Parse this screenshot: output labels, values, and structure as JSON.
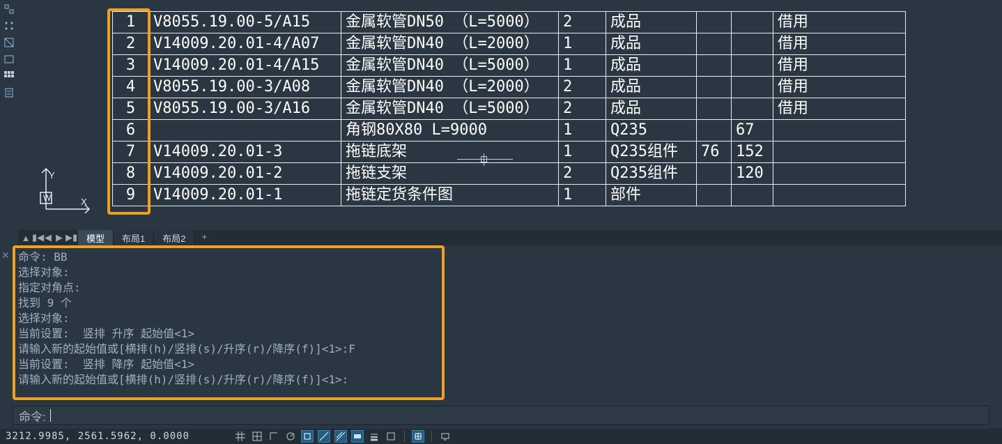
{
  "table": {
    "rows": [
      {
        "n": "1",
        "code": "V8055.19.00-5/A15",
        "desc": "金属软管DN50 （L=5000）",
        "qty": "2",
        "mat": "成品",
        "a": "",
        "b": "",
        "note": "借用"
      },
      {
        "n": "2",
        "code": "V14009.20.01-4/A07",
        "desc": "金属软管DN40 （L=2000）",
        "qty": "1",
        "mat": "成品",
        "a": "",
        "b": "",
        "note": "借用"
      },
      {
        "n": "3",
        "code": "V14009.20.01-4/A15",
        "desc": "金属软管DN40 （L=5000）",
        "qty": "1",
        "mat": "成品",
        "a": "",
        "b": "",
        "note": "借用"
      },
      {
        "n": "4",
        "code": "V8055.19.00-3/A08",
        "desc": "金属软管DN40 （L=2000）",
        "qty": "2",
        "mat": "成品",
        "a": "",
        "b": "",
        "note": "借用"
      },
      {
        "n": "5",
        "code": "V8055.19.00-3/A16",
        "desc": "金属软管DN40 （L=5000）",
        "qty": "2",
        "mat": "成品",
        "a": "",
        "b": "",
        "note": "借用"
      },
      {
        "n": "6",
        "code": "",
        "desc": "角钢80X80  L=9000",
        "qty": "1",
        "mat": "Q235",
        "a": "",
        "b": "67",
        "note": ""
      },
      {
        "n": "7",
        "code": "V14009.20.01-3",
        "desc": "拖链底架",
        "qty": "1",
        "mat": "Q235组件",
        "a": "76",
        "b": "152",
        "note": ""
      },
      {
        "n": "8",
        "code": "V14009.20.01-2",
        "desc": "拖链支架",
        "qty": "2",
        "mat": "Q235组件",
        "a": "",
        "b": "120",
        "note": ""
      },
      {
        "n": "9",
        "code": "V14009.20.01-1",
        "desc": "拖链定货条件图",
        "qty": "1",
        "mat": "部件",
        "a": "",
        "b": "",
        "note": ""
      }
    ]
  },
  "tabs": {
    "model": "模型",
    "layout1": "布局1",
    "layout2": "布局2",
    "add": "+"
  },
  "cmd_history": [
    "命令: BB",
    "选择对象:",
    "指定对角点:",
    "找到 9 个",
    "选择对象:",
    "当前设置:  竖排 升序 起始值<1>",
    "请输入新的起始值或[横排(h)/竖排(s)/升序(r)/降序(f)]<1>:F",
    "当前设置:  竖排 降序 起始值<1>",
    "请输入新的起始值或[横排(h)/竖排(s)/升序(r)/降序(f)]<1>:"
  ],
  "cmd_prompt": "命令:",
  "status": {
    "coords": "3212.9985, 2561.5962, 0.0000"
  },
  "ucs_labels": {
    "y": "Y",
    "w": "W",
    "x": "X"
  }
}
